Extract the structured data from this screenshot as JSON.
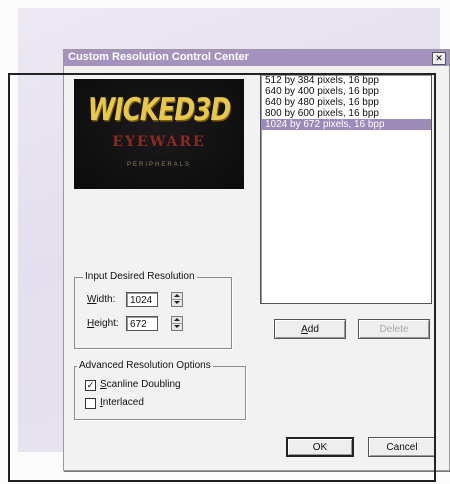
{
  "window": {
    "title": "Custom Resolution Control Center",
    "close_glyph": "✕"
  },
  "logo": {
    "main": "WICKED3D",
    "sub": "EYEWARE",
    "tag": "PERIPHERALS",
    "colors": {
      "main": "#e8c84a",
      "sub": "#8a2a22",
      "background": "#111111"
    }
  },
  "resolution_list": {
    "items": [
      "512 by 384 pixels,  16 bpp",
      "640 by 400 pixels,  16 bpp",
      "640 by 480 pixels,  16 bpp",
      "800 by 600 pixels,  16 bpp",
      "1024 by 672 pixels,  16 bpp"
    ],
    "selected_index": 4,
    "selection_color": "#9c8ab8"
  },
  "desired_resolution": {
    "group_label": "Input Desired Resolution",
    "width_label_u": "W",
    "width_label_rest": "idth:",
    "width_value": "1024",
    "height_label_u": "H",
    "height_label_rest": "eight:",
    "height_value": "672"
  },
  "advanced": {
    "group_label": "Advanced Resolution Options",
    "scanline_u": "S",
    "scanline_rest": "canline Doubling",
    "scanline_checked": true,
    "interlaced_u": "I",
    "interlaced_rest": "nterlaced",
    "interlaced_checked": false,
    "check_glyph": "✓"
  },
  "buttons": {
    "add_u": "A",
    "add_rest": "dd",
    "delete": "Delete",
    "ok": "OK",
    "cancel": "Cancel"
  },
  "colors": {
    "titlebar": "#a493be",
    "dialog_face": "#f2f2f2",
    "backdrop": "#e9e4f0"
  }
}
